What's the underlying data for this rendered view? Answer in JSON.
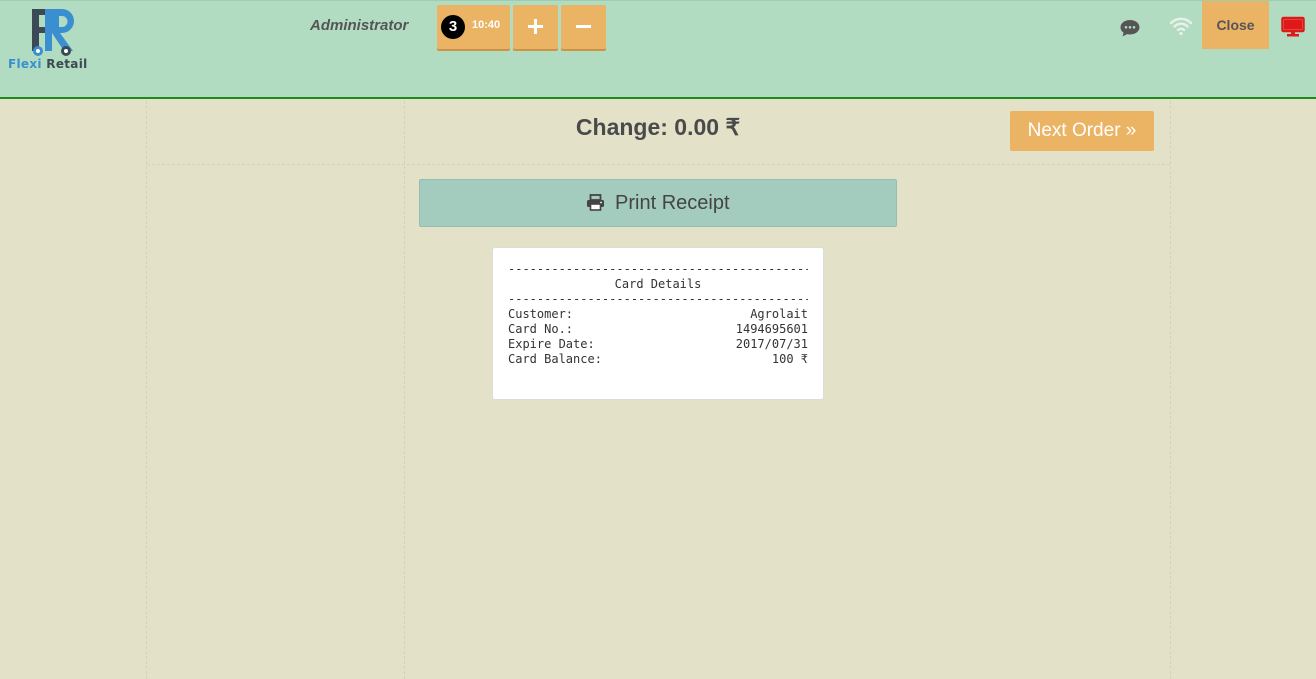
{
  "app": {
    "logo_text_1": "Flexi",
    "logo_text_2": "Retail",
    "logo_letters": "FR"
  },
  "header": {
    "user": "Administrator",
    "order_number": "3",
    "order_time": "10:40",
    "add_label": "+",
    "remove_label": "−",
    "close_label": "Close"
  },
  "main": {
    "change_label": "Change: 0.00 ₹",
    "next_order_label": "Next Order »",
    "print_label": "Print Receipt"
  },
  "receipt": {
    "rule": "------------------------------------------",
    "title": "Card Details",
    "rows": [
      {
        "label": "Customer:",
        "value": "Agrolait"
      },
      {
        "label": "Card No.:",
        "value": "1494695601"
      },
      {
        "label": "Expire Date:",
        "value": "2017/07/31"
      },
      {
        "label": "Card Balance:",
        "value": "100 ₹"
      }
    ]
  },
  "colors": {
    "header_bg": "#b2dcc1",
    "page_bg": "#e3e1c8",
    "accent": "#ebb464",
    "print_btn": "#a3cbbe",
    "header_border": "#1e8a1e",
    "screen_icon": "#e01818"
  },
  "icons": {
    "chat": "chat-bubble-icon",
    "wifi": "wifi-icon",
    "screen": "monitor-icon",
    "print": "printer-icon"
  }
}
